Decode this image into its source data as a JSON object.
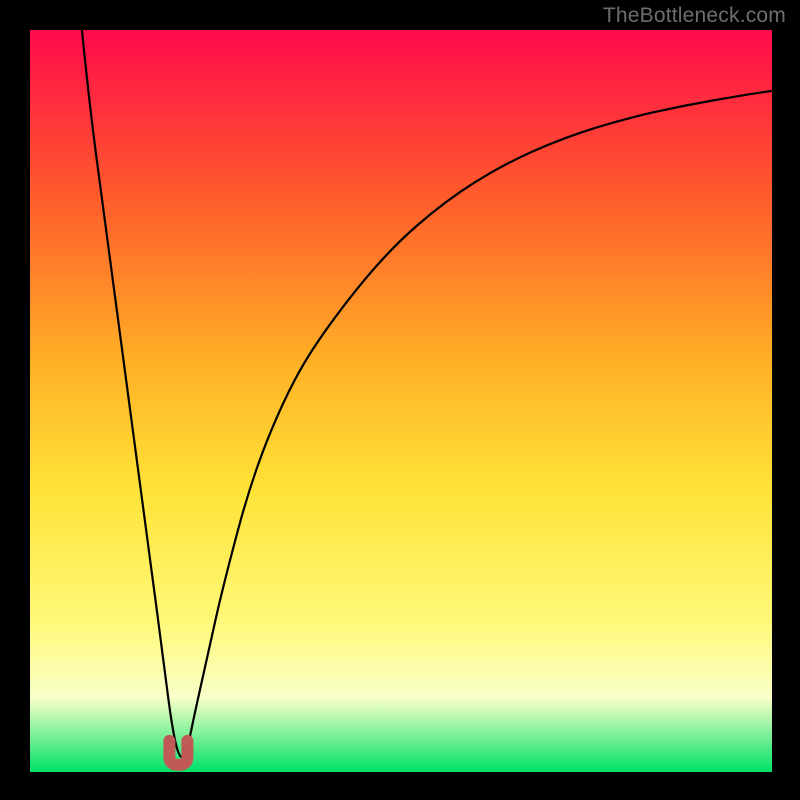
{
  "watermark": "TheBottleneck.com",
  "colors": {
    "frame": "#000000",
    "marker": "#c05a57",
    "curve": "#000000",
    "gradient_top": "#ff0a4b",
    "gradient_mid1": "#ff5a2c",
    "gradient_mid2": "#ffb126",
    "gradient_mid3": "#ffe338",
    "gradient_mid4": "#fff97a",
    "gradient_band": "#f9ffc9",
    "gradient_bottom": "#00e169"
  },
  "chart_data": {
    "type": "line",
    "title": "",
    "xlabel": "",
    "ylabel": "",
    "xlim": [
      0,
      100
    ],
    "ylim": [
      0,
      100
    ],
    "grid": false,
    "series": [
      {
        "name": "bottleneck-curve",
        "x": [
          7,
          8,
          10,
          12,
          14,
          16,
          18,
          19,
          20,
          21,
          22,
          24,
          26,
          30,
          35,
          40,
          48,
          56,
          64,
          72,
          80,
          88,
          96,
          100
        ],
        "y": [
          100,
          90,
          75,
          60,
          45,
          30,
          15,
          7,
          2,
          2,
          7,
          16,
          25,
          40,
          52,
          60,
          70,
          77,
          82,
          85.5,
          88,
          89.8,
          91.2,
          91.8
        ]
      }
    ],
    "annotations": [
      {
        "name": "optimal-marker",
        "x": 20,
        "y": 1.5,
        "shape": "u",
        "color": "#c05a57"
      }
    ],
    "background": {
      "type": "vertical-gradient",
      "description": "red (high bottleneck) at top through orange/yellow to green (no bottleneck) at bottom",
      "stops": [
        {
          "pos": 0.0,
          "color": "#ff0a4b"
        },
        {
          "pos": 0.22,
          "color": "#ff5a2c"
        },
        {
          "pos": 0.45,
          "color": "#ffb126"
        },
        {
          "pos": 0.62,
          "color": "#ffe338"
        },
        {
          "pos": 0.8,
          "color": "#fff97a"
        },
        {
          "pos": 0.9,
          "color": "#f9ffc9"
        },
        {
          "pos": 1.0,
          "color": "#00e169"
        }
      ]
    }
  },
  "layout": {
    "inner_x": 30,
    "inner_y": 30,
    "inner_w": 742,
    "inner_h": 742
  }
}
